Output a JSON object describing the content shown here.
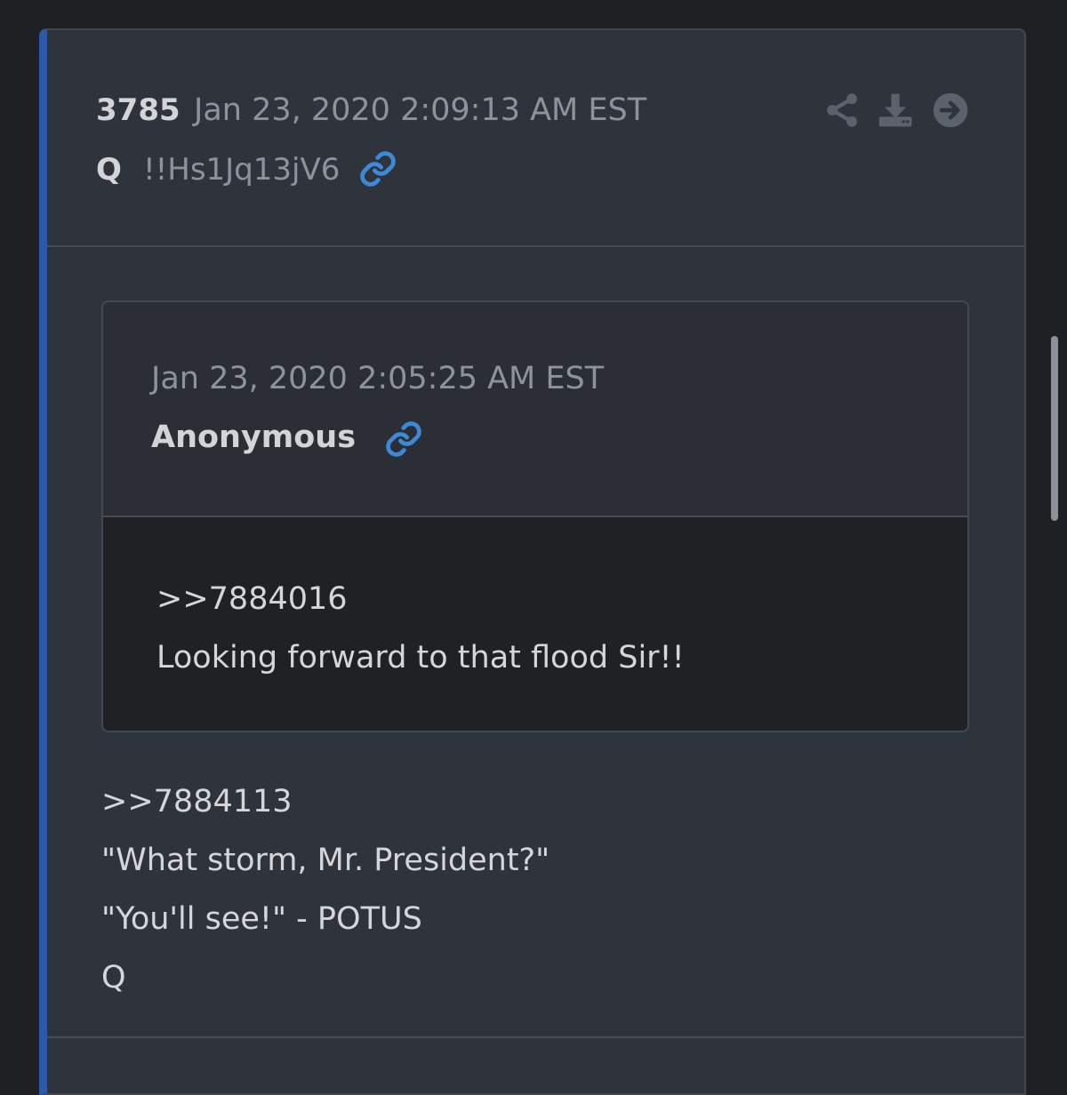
{
  "post": {
    "number": "3785",
    "date": "Jan 23, 2020 2:09:13 AM EST",
    "author": "Q",
    "tripcode": "!!Hs1Jq13jV6"
  },
  "actions": {
    "share_icon": "share-icon",
    "download_icon": "download-icon",
    "next_icon": "arrow-right-circle-icon"
  },
  "quoted": {
    "date": "Jan 23, 2020 2:05:25 AM EST",
    "author": "Anonymous",
    "lines": [
      ">>7884016",
      "Looking forward to that flood Sir!!"
    ]
  },
  "body": {
    "lines": [
      ">>7884113",
      "\"What storm, Mr. President?\"",
      "\"You'll see!\" - POTUS",
      "Q"
    ]
  },
  "colors": {
    "accent": "#2d5aa8",
    "link": "#3e89d6",
    "card_bg": "#2f333c",
    "page_bg": "#1e2024"
  }
}
